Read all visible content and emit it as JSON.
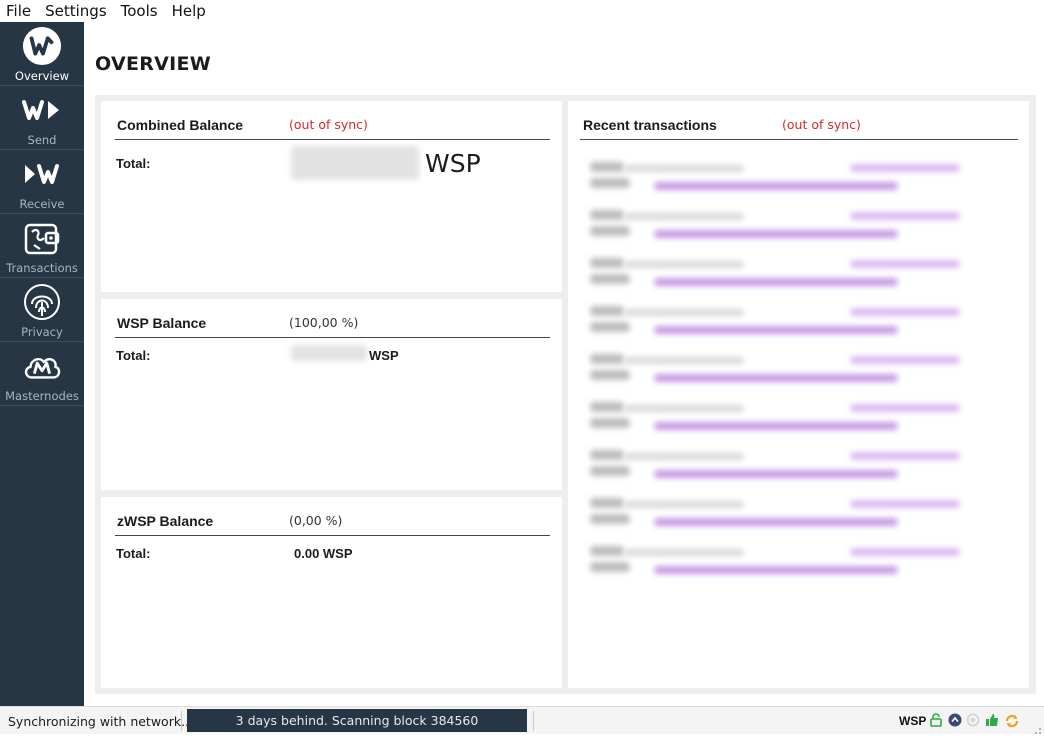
{
  "menu": [
    "File",
    "Settings",
    "Tools",
    "Help"
  ],
  "sidebar": {
    "items": [
      {
        "label": "Overview",
        "icon": "wsp-logo-icon",
        "active": true
      },
      {
        "label": "Send",
        "icon": "send-icon"
      },
      {
        "label": "Receive",
        "icon": "receive-icon"
      },
      {
        "label": "Transactions",
        "icon": "wallet-icon"
      },
      {
        "label": "Privacy",
        "icon": "fingerprint-icon"
      },
      {
        "label": "Masternodes",
        "icon": "cloud-m-icon"
      }
    ]
  },
  "page": {
    "title": "OVERVIEW"
  },
  "combined": {
    "title": "Combined Balance",
    "note": "(out of sync)",
    "total_label": "Total:",
    "unit": "WSP"
  },
  "wsp": {
    "title": "WSP Balance",
    "percent": "(100,00 %)",
    "total_label": "Total:",
    "unit": "WSP"
  },
  "zwsp": {
    "title": "zWSP Balance",
    "percent": "(0,00 %)",
    "total_label": "Total:",
    "value": "0.00 WSP"
  },
  "recent": {
    "title": "Recent transactions",
    "note": "(out of sync)",
    "rows": 9
  },
  "status": {
    "sync_text": "Synchronizing with network...",
    "progress_text": "3 days behind. Scanning block 384560",
    "unit": "WSP"
  },
  "colors": {
    "sidebar": "#263645",
    "accent_purple": "#c89be6",
    "out_of_sync": "#d32a2a"
  }
}
